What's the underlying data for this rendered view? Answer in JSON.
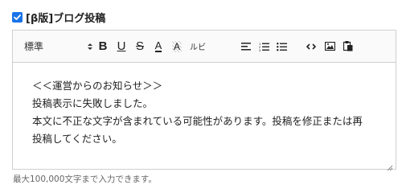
{
  "beta_option": {
    "checked": true,
    "label": "[β版]ブログ投稿"
  },
  "toolbar": {
    "format_select_value": "標準",
    "buttons": [
      {
        "name": "bold",
        "glyph": "B"
      },
      {
        "name": "underline",
        "glyph": "U"
      },
      {
        "name": "strikethrough",
        "glyph": "S"
      },
      {
        "name": "font-color",
        "glyph": "A"
      },
      {
        "name": "highlight",
        "glyph": "A"
      },
      {
        "name": "ruby",
        "glyph": "ルビ"
      },
      {
        "name": "align",
        "glyph": ""
      },
      {
        "name": "ordered-list",
        "glyph": ""
      },
      {
        "name": "bullet-list",
        "glyph": ""
      },
      {
        "name": "code",
        "glyph": "‹›"
      },
      {
        "name": "image",
        "glyph": ""
      },
      {
        "name": "paste",
        "glyph": ""
      }
    ]
  },
  "editor_content": {
    "line1": "＜＜運営からのお知らせ＞＞",
    "line2": "投稿表示に失敗しました。",
    "line3": "本文に不正な文字が含まれている可能性があります。投稿を修正または再",
    "line4": "投稿してください。"
  },
  "hint_text": "最大100,000文字まで入力できます。",
  "colors": {
    "checkbox": "#1a73e8",
    "border": "#cfcfcf",
    "hint": "#666666"
  }
}
